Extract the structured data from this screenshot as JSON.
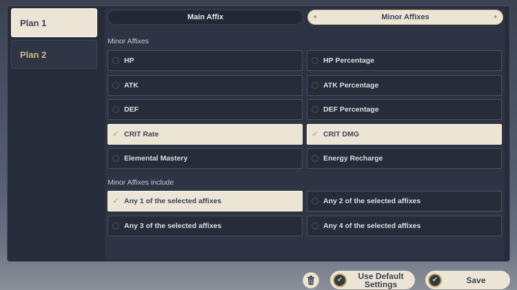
{
  "plans": [
    {
      "label": "Plan 1",
      "active": true
    },
    {
      "label": "Plan 2",
      "active": false
    }
  ],
  "tabs": [
    {
      "label": "Main Affix",
      "active": false
    },
    {
      "label": "Minor Affixes",
      "active": true
    }
  ],
  "minor_affixes": {
    "heading": "Minor Affixes",
    "options": [
      {
        "label": "HP",
        "selected": false
      },
      {
        "label": "HP Percentage",
        "selected": false
      },
      {
        "label": "ATK",
        "selected": false
      },
      {
        "label": "ATK Percentage",
        "selected": false
      },
      {
        "label": "DEF",
        "selected": false
      },
      {
        "label": "DEF Percentage",
        "selected": false
      },
      {
        "label": "CRIT Rate",
        "selected": true
      },
      {
        "label": "CRIT DMG",
        "selected": true
      },
      {
        "label": "Elemental Mastery",
        "selected": false
      },
      {
        "label": "Energy Recharge",
        "selected": false
      }
    ]
  },
  "include": {
    "heading": "Minor Affixes include",
    "options": [
      {
        "label": "Any 1 of the selected affixes",
        "selected": true
      },
      {
        "label": "Any 2 of the selected affixes",
        "selected": false
      },
      {
        "label": "Any 3 of the selected affixes",
        "selected": false
      },
      {
        "label": "Any 4 of the selected affixes",
        "selected": false
      }
    ]
  },
  "footer": {
    "trash_icon": "trash-icon",
    "default_label": "Use Default\nSettings",
    "save_label": "Save"
  },
  "colors": {
    "selected_bg": "#ece5d6",
    "check": "#8ab04c",
    "accent_gold": "#c6a65a"
  }
}
